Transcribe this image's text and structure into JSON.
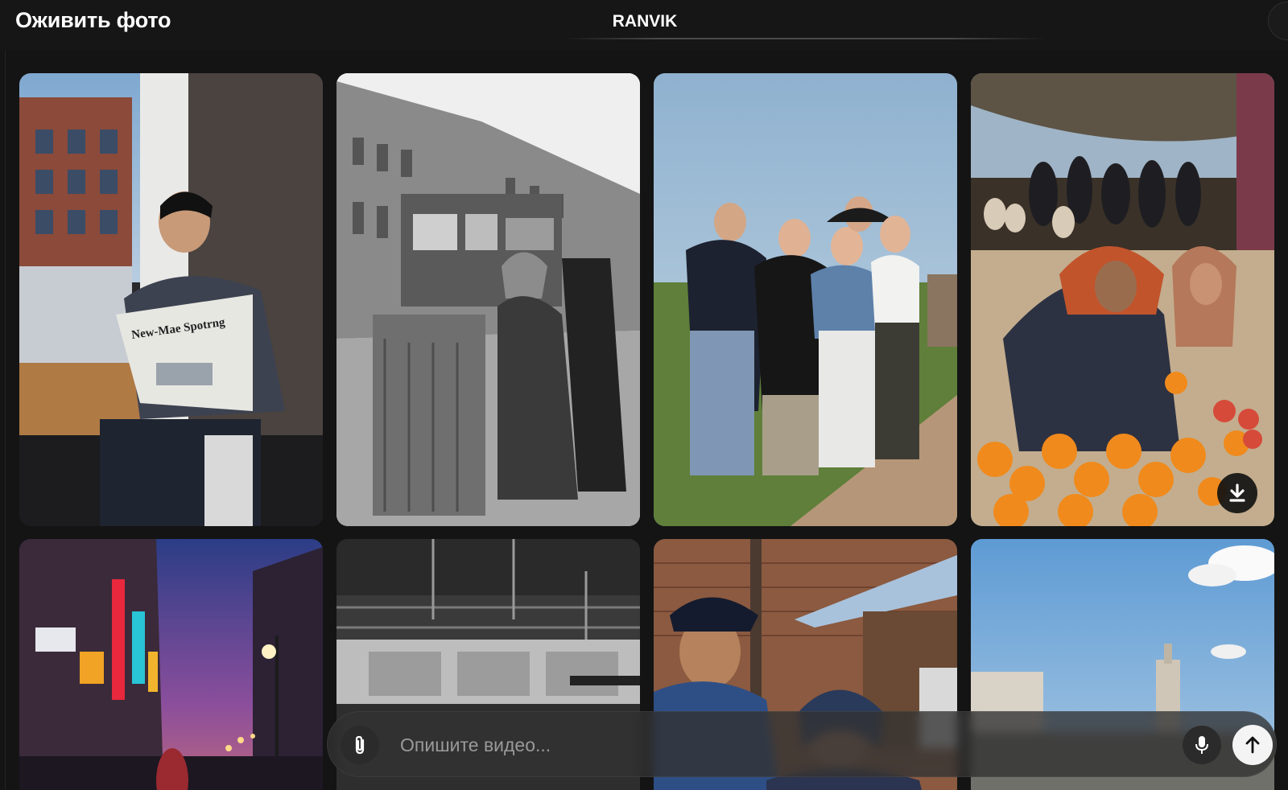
{
  "header": {
    "title": "Оживить фото",
    "brand": "RANVIK"
  },
  "gallery": {
    "items": [
      {
        "icon": "man-reading-newspaper-photo",
        "newspaper_text": "New-Mae Spotrng"
      },
      {
        "icon": "old-street-tram-photo"
      },
      {
        "icon": "group-of-friends-photo"
      },
      {
        "icon": "market-oranges-photo"
      },
      {
        "icon": "neon-street-night-photo"
      },
      {
        "icon": "old-factory-photo"
      },
      {
        "icon": "boy-and-woman-village-photo"
      },
      {
        "icon": "city-square-sky-photo"
      }
    ]
  },
  "prompt": {
    "placeholder": "Опишите видео..."
  },
  "icons": {
    "attach": "paperclip-icon",
    "mic": "microphone-icon",
    "send": "arrow-up-icon",
    "download": "download-icon"
  }
}
